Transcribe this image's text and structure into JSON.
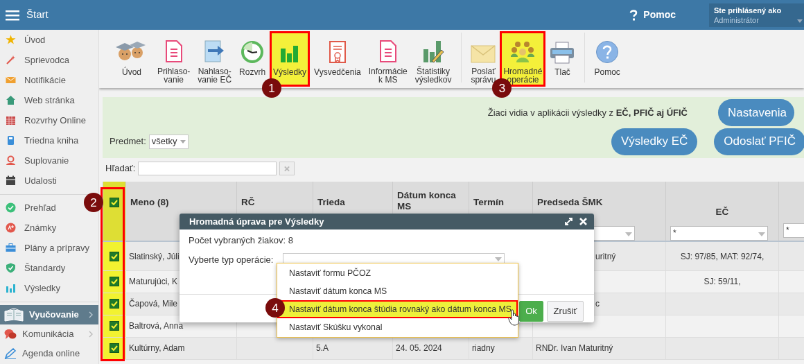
{
  "topbar": {
    "title": "Štart",
    "help": "Pomoc",
    "user_label": "Ste prihlásený ako",
    "user_name": "Administrátor"
  },
  "sidebar": {
    "groups": [
      [
        {
          "label": "Úvod"
        },
        {
          "label": "Sprievodca"
        },
        {
          "label": "Notifikácie"
        },
        {
          "label": "Web stránka"
        },
        {
          "label": "Rozvrhy Online"
        },
        {
          "label": "Triedna kniha"
        },
        {
          "label": "Suplovanie"
        },
        {
          "label": "Udalosti"
        }
      ],
      [
        {
          "label": "Prehľad"
        },
        {
          "label": "Známky"
        },
        {
          "label": "Plány a prípravy"
        },
        {
          "label": "Štandardy"
        },
        {
          "label": "Výsledky"
        }
      ]
    ],
    "sections": [
      {
        "label": "Vyučovanie",
        "selected": true,
        "submenu": true
      },
      {
        "label": "Komunikácia",
        "selected": false,
        "submenu": true
      },
      {
        "label": "Agenda online",
        "selected": false,
        "submenu": false
      }
    ]
  },
  "toolbar": {
    "groups": [
      [
        {
          "label": "Úvod",
          "highlighted": false
        },
        {
          "label": "Prihlaso-\nvanie",
          "highlighted": false
        },
        {
          "label": "Nahlaso-\nvanie EČ",
          "highlighted": false
        },
        {
          "label": "Rozvrh",
          "highlighted": false
        },
        {
          "label": "Výsledky",
          "highlighted": true,
          "annotation": "1"
        },
        {
          "label": "Vysvedčenia",
          "highlighted": false
        },
        {
          "label": "Informácie\nk MS",
          "highlighted": false
        },
        {
          "label": "Štatistiky\nvýsledkov",
          "highlighted": false
        }
      ],
      [
        {
          "label": "Poslať\nsprávu",
          "highlighted": false
        },
        {
          "label": "Hromadné\noperácie",
          "highlighted": true,
          "annotation": "3"
        },
        {
          "label": "Tlač",
          "highlighted": false
        }
      ],
      [
        {
          "label": "Pomoc",
          "highlighted": false
        }
      ]
    ]
  },
  "info_panel": {
    "notice": "Žiaci vidia v aplikácii výsledky z **EČ, PFIČ aj ÚFIČ**",
    "settings_button": "Nastavenia",
    "filter_label": "Predmet:",
    "filter_value": "všetky",
    "buttons": [
      "Výsledky EČ",
      "Odoslať PFIČ"
    ]
  },
  "search": {
    "label": "Hľadať:"
  },
  "table": {
    "selection": {
      "all_checked": true,
      "highlighted": true,
      "annotation": "2"
    },
    "columns": [
      {
        "label": "Meno (8)",
        "filter": false
      },
      {
        "label": "RČ",
        "filter": false
      },
      {
        "label": "Trieda",
        "filter": false
      },
      {
        "label": "Dátum konca MS",
        "filter": false
      },
      {
        "label": "Termín",
        "filter": false
      },
      {
        "label": "Predseda ŠMK",
        "filter": true
      },
      {
        "label": "EČ",
        "filter": true,
        "filter_value": "*"
      },
      {
        "filter": true,
        "filter_value": "*"
      }
    ],
    "rows": [
      {
        "checked": true,
        "name": "Slatinský, Júli",
        "chair": "uritný",
        "ec": "SJ: 97/85, MAT: 92/74,"
      },
      {
        "checked": true,
        "name": "Maturujúci, K",
        "ec": "SJ: 59/11,"
      },
      {
        "checked": true,
        "name": "Čapová, Mile",
        "chair": "c"
      },
      {
        "checked": true,
        "name": "Baltrová, Anna"
      },
      {
        "checked": true,
        "name": "Kultúrny, Adam",
        "class": "5.A",
        "end_date": "24. 05. 2024",
        "term": "riadny",
        "chair": "RNDr. Ivan Maturitný"
      }
    ]
  },
  "modal": {
    "title": "Hromadná úprava pre Výsledky",
    "count": "Počet vybraných žiakov: 8",
    "operation_label": "Vyberte typ operácie:",
    "options": [
      {
        "label": "Nastaviť formu PČOZ",
        "selected": false
      },
      {
        "label": "Nastaviť dátum konca MS",
        "selected": false
      },
      {
        "label": "Nastaviť dátum konca štúdia rovnaký ako dátum konca MS",
        "selected": true,
        "annotation": "4"
      },
      {
        "label": "Nastaviť Skúšku vykonal",
        "selected": false
      }
    ],
    "buttons": [
      {
        "label": "Ok",
        "kind": "primary"
      },
      {
        "label": "Zrušiť",
        "kind": "secondary"
      }
    ]
  }
}
